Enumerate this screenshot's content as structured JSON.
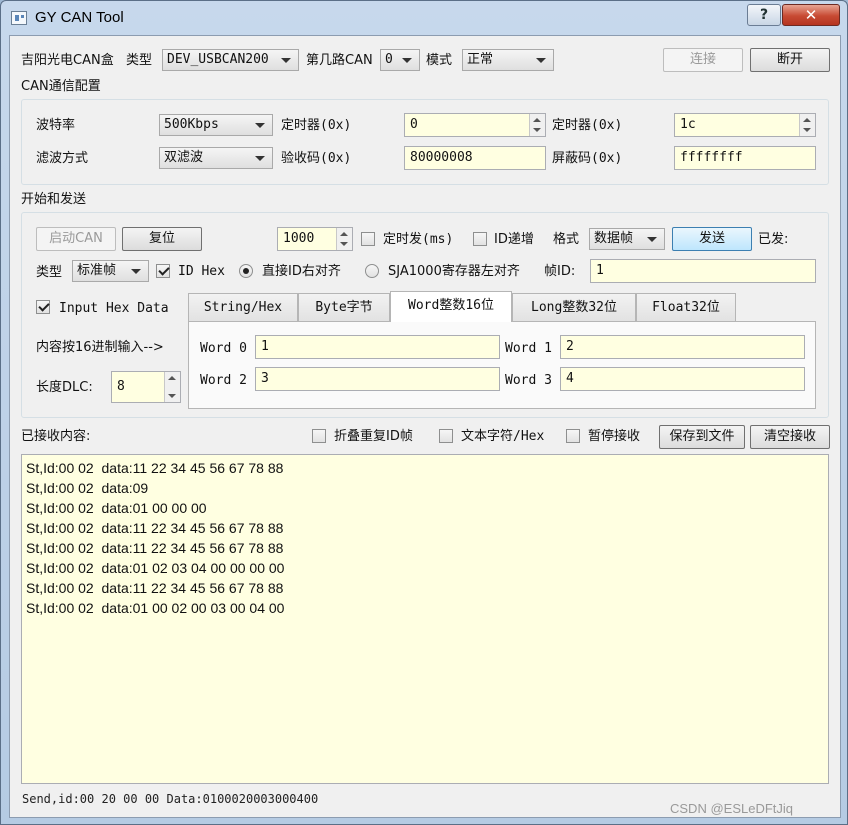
{
  "window": {
    "title": "GY CAN Tool",
    "help": "?",
    "close": "✕"
  },
  "top": {
    "device_label": "吉阳光电CAN盒",
    "type_label": "类型",
    "type_value": "DEV_USBCAN200",
    "channel_label": "第几路CAN",
    "channel_value": "0",
    "mode_label": "模式",
    "mode_value": "正常",
    "connect": "连接",
    "disconnect": "断开"
  },
  "config": {
    "title": "CAN通信配置",
    "baud_label": "波特率",
    "baud_value": "500Kbps",
    "timer0_label": "定时器(0x)",
    "timer0_value": "0",
    "timer1_label": "定时器(0x)",
    "timer1_value": "1c",
    "filter_label": "滤波方式",
    "filter_value": "双滤波",
    "acc_label": "验收码(0x)",
    "acc_value": "80000008",
    "mask_label": "屏蔽码(0x)",
    "mask_value": "ffffffff"
  },
  "send": {
    "title": "开始和发送",
    "start": "启动CAN",
    "reset": "复位",
    "interval_value": "1000",
    "timed_label": "定时发(ms)",
    "idinc_label": "ID递增",
    "format_label": "格式",
    "format_value": "数据帧",
    "send_btn": "发送",
    "sent_label": "已发:",
    "type_label": "类型",
    "type_value": "标准帧",
    "idhex_label": "ID Hex",
    "radio_direct": "直接ID右对齐",
    "radio_sja": "SJA1000寄存器左对齐",
    "frameid_label": "帧ID:",
    "frameid_value": "1",
    "input_hex_label": "Input Hex Data",
    "content_label": "内容按16进制输入-->",
    "dlc_label": "长度DLC:",
    "dlc_value": "8",
    "tabs": [
      "String/Hex",
      "Byte字节",
      "Word整数16位",
      "Long整数32位",
      "Float32位"
    ],
    "words": [
      {
        "label": "Word 0",
        "value": "1"
      },
      {
        "label": "Word 1",
        "value": "2"
      },
      {
        "label": "Word 2",
        "value": "3"
      },
      {
        "label": "Word 3",
        "value": "4"
      }
    ]
  },
  "receive": {
    "title": "已接收内容:",
    "fold_label": "折叠重复ID帧",
    "text_label": "文本字符/Hex",
    "pause_label": "暂停接收",
    "save": "保存到文件",
    "clear": "清空接收",
    "lines": [
      "St,Id:00 02  data:11 22 34 45 56 67 78 88",
      "St,Id:00 02  data:09",
      "St,Id:00 02  data:01 00 00 00",
      "St,Id:00 02  data:11 22 34 45 56 67 78 88",
      "St,Id:00 02  data:11 22 34 45 56 67 78 88",
      "St,Id:00 02  data:01 02 03 04 00 00 00 00",
      "St,Id:00 02  data:11 22 34 45 56 67 78 88",
      "St,Id:00 02  data:01 00 02 00 03 00 04 00"
    ]
  },
  "status": "Send,id:00 20 00 00 Data:0100020003000400",
  "watermark": "CSDN @ESLeDFtJiq"
}
